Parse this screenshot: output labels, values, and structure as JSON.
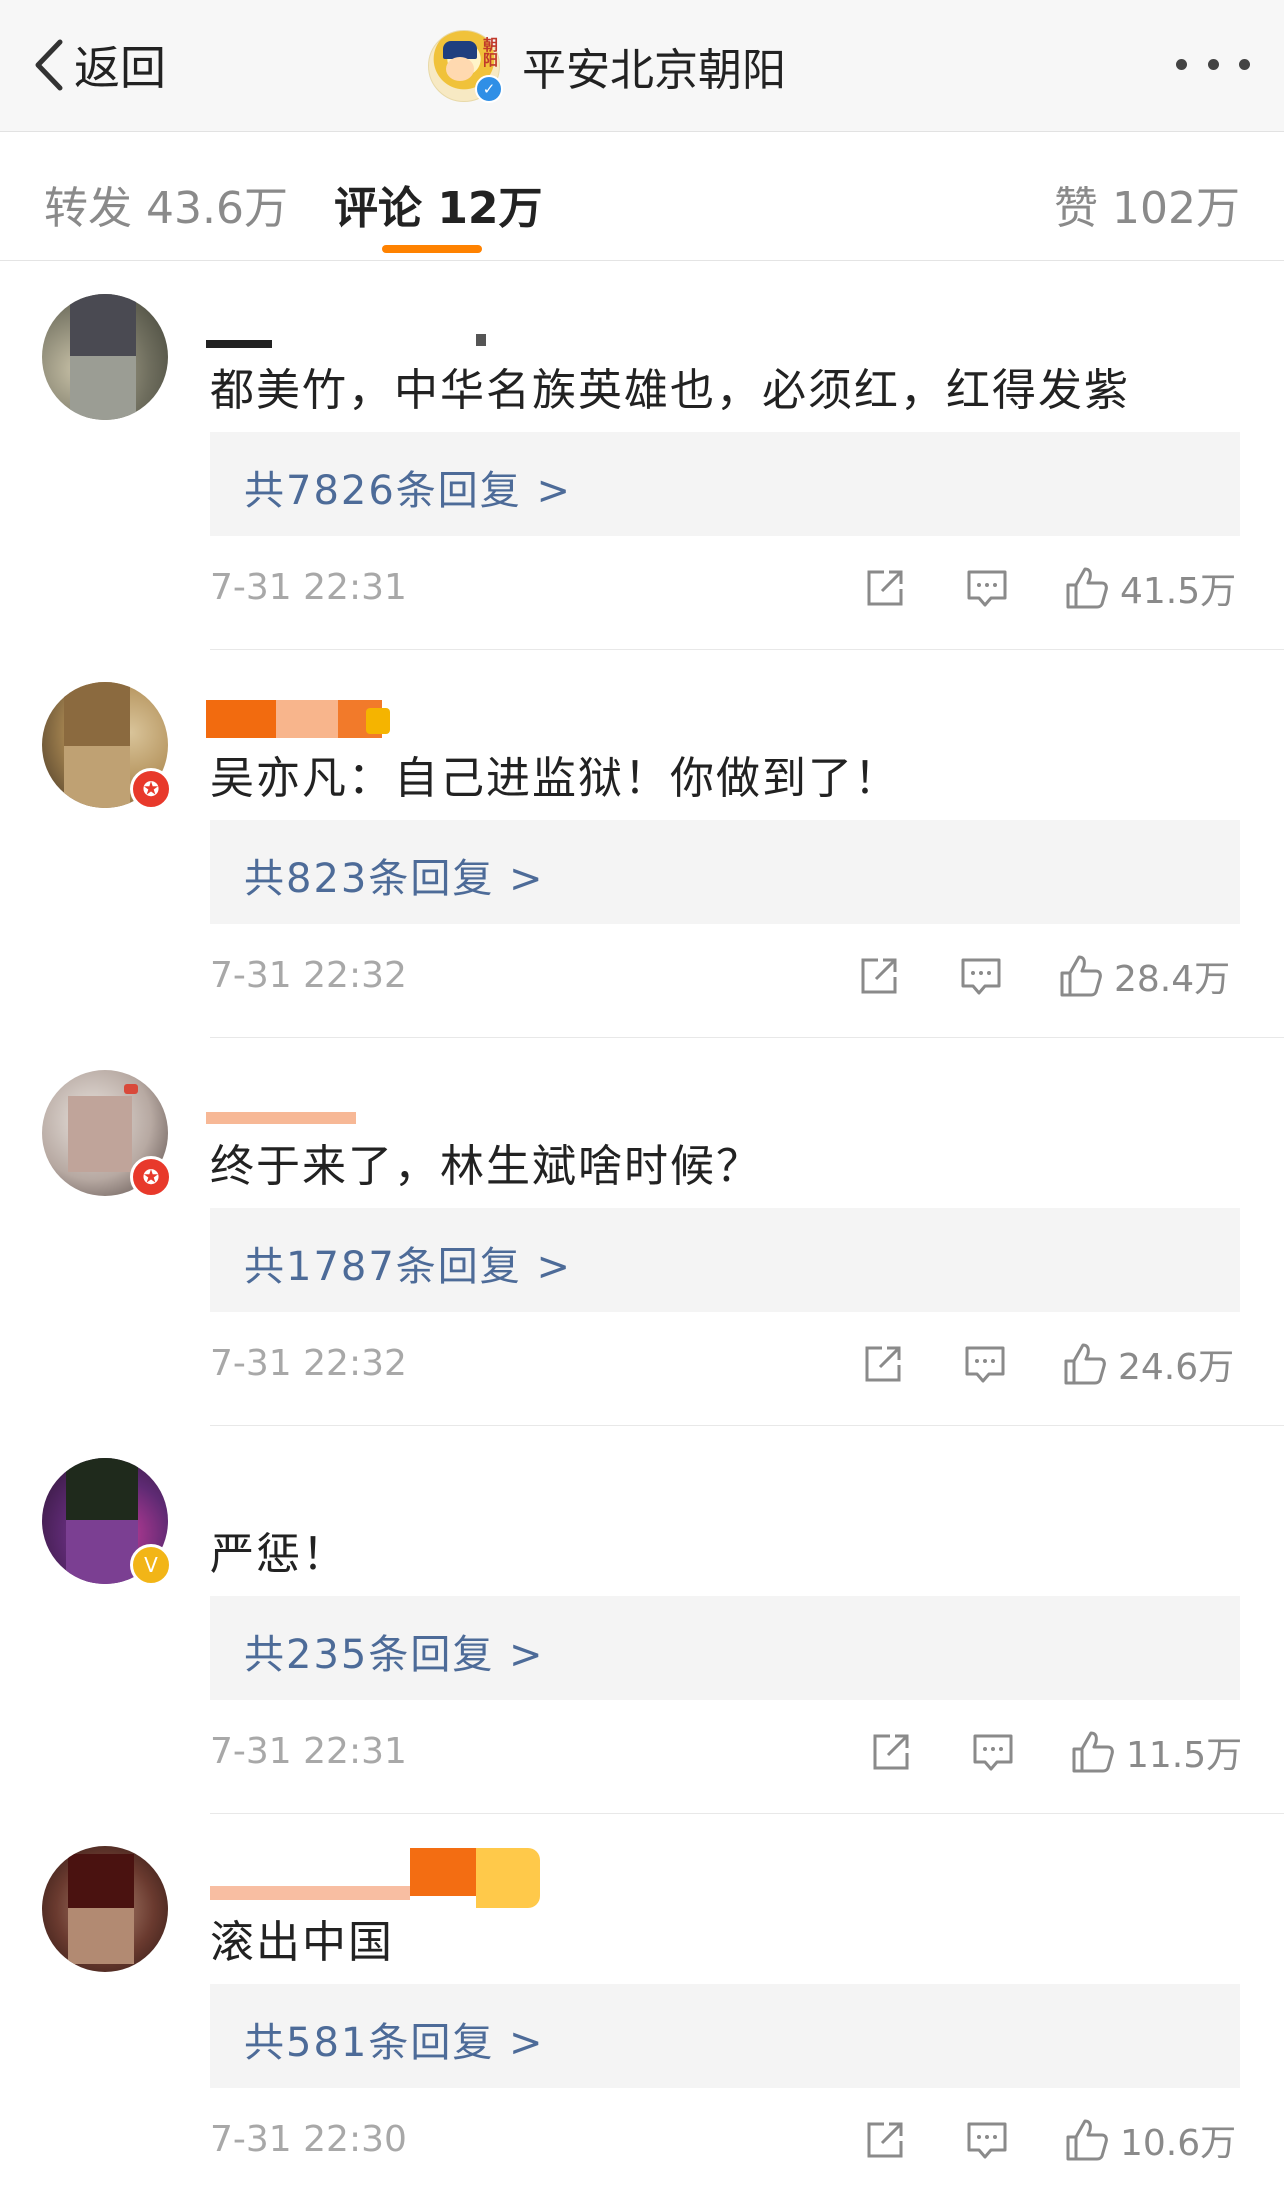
{
  "nav": {
    "back_label": "返回",
    "account_name": "平安北京朝阳",
    "account_badge": "朝阳"
  },
  "tabs": {
    "repost": "转发 43.6万",
    "comment": "评论 12万",
    "like": "赞 102万",
    "active": "comment"
  },
  "colors": {
    "accent": "#ff8200",
    "link": "#4d6b98",
    "verified_blue": "#2f8fe6",
    "badge_red": "#e8392b",
    "badge_gold": "#f2b517"
  },
  "comments": [
    {
      "text": "都美竹，中华名族英雄也，必须红，红得发紫",
      "replies": "共7826条回复 >",
      "time": "7-31 22:31",
      "likes": "41.5万"
    },
    {
      "text": "吴亦凡：自己进监狱！你做到了！",
      "replies": "共823条回复 >",
      "time": "7-31 22:32",
      "likes": "28.4万"
    },
    {
      "text": "终于来了，林生斌啥时候？",
      "replies": "共1787条回复 >",
      "time": "7-31 22:32",
      "likes": "24.6万"
    },
    {
      "text": "严惩！",
      "replies": "共235条回复 >",
      "time": "7-31 22:31",
      "likes": "11.5万"
    },
    {
      "text": "滚出中国",
      "replies": "共581条回复 >",
      "time": "7-31 22:30",
      "likes": "10.6万"
    }
  ],
  "icons": {
    "back": "chevron-left-icon",
    "more": "more-dots-icon",
    "share": "share-icon",
    "comment": "comment-bubble-icon",
    "like": "thumbs-up-icon"
  }
}
